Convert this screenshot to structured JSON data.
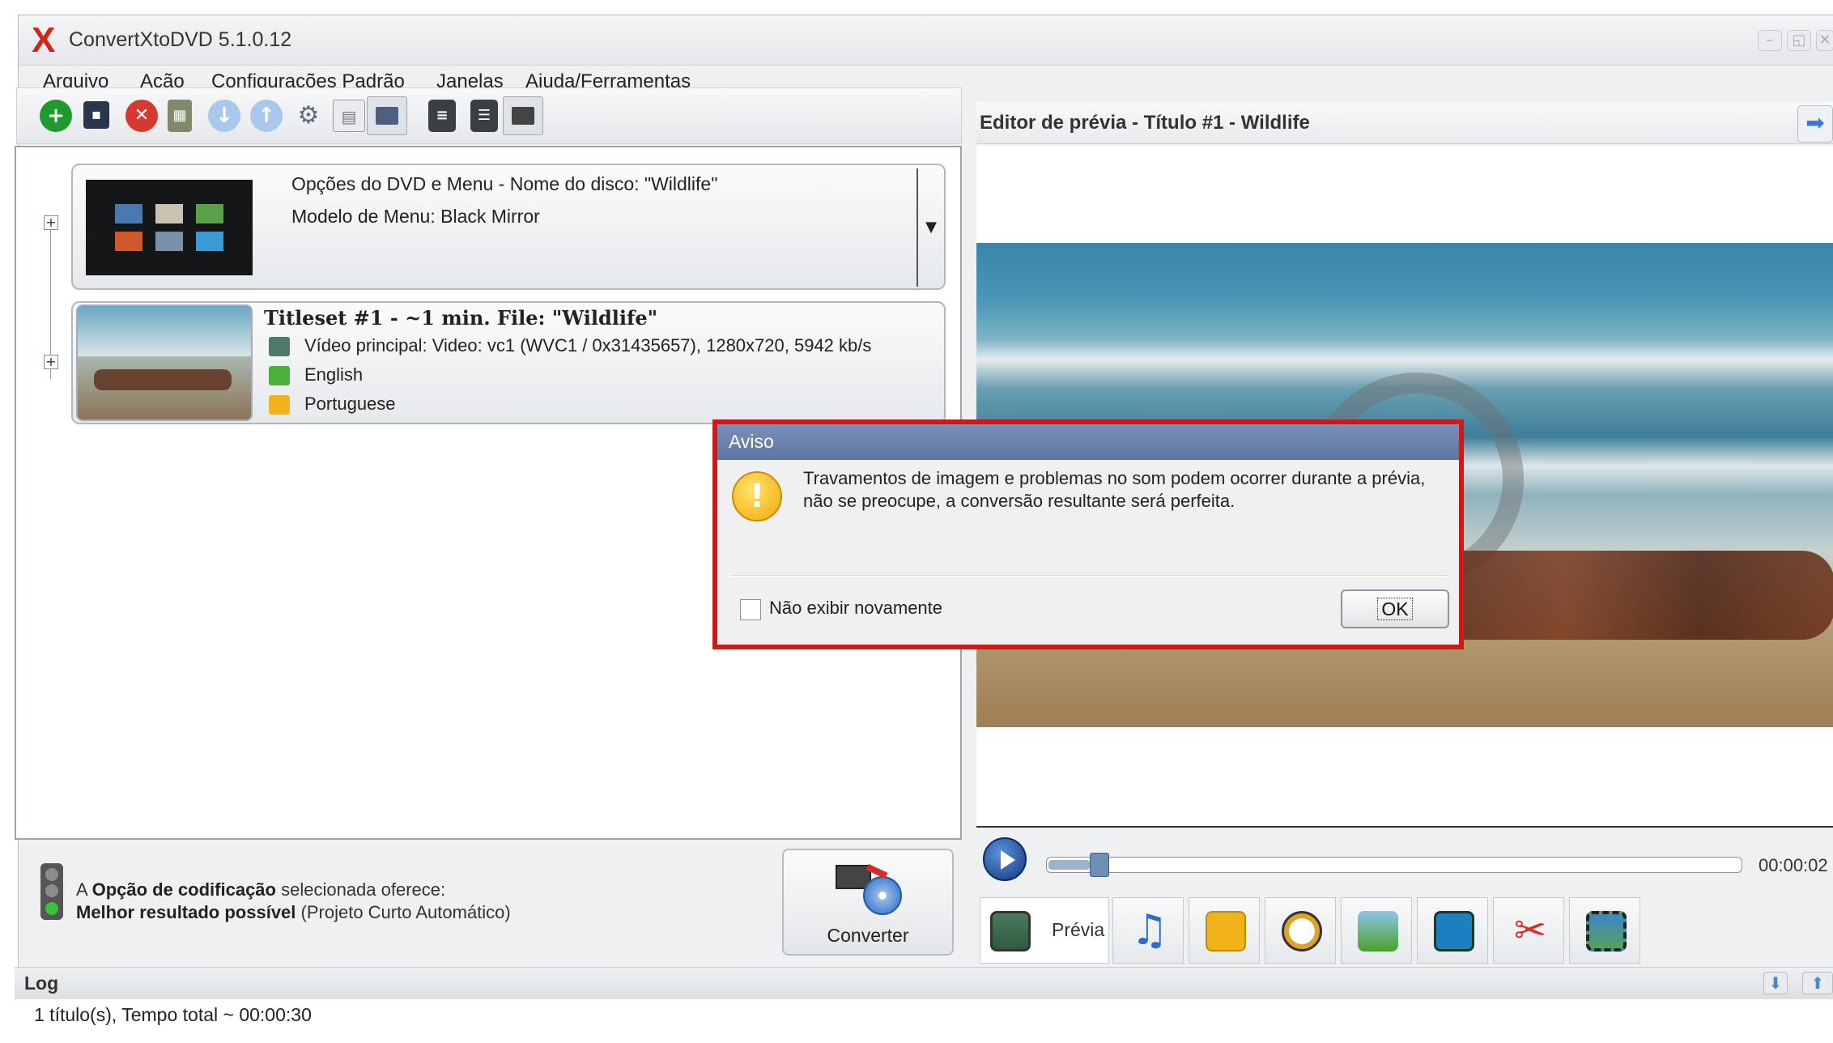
{
  "window": {
    "logo": "X",
    "title": "ConvertXtoDVD 5.1.0.12"
  },
  "menu": {
    "items": [
      "Arquivo",
      "Ação",
      "Configurações Padrão",
      "Janelas",
      "Ajuda/Ferramentas"
    ]
  },
  "toolbar": {
    "icons": [
      "add-icon",
      "save-icon",
      "remove-icon",
      "chapters-icon",
      "move-down-icon",
      "move-up-icon",
      "settings-icon",
      "menu-grid-icon",
      "preview-monitor-icon",
      "list-view-icon",
      "compact-view-icon",
      "tv-view-icon"
    ]
  },
  "project": {
    "dvd": {
      "line1": "Opções do DVD e Menu - Nome do disco: \"Wildlife\"",
      "line2": "Modelo de Menu: Black Mirror",
      "dropdown_glyph": "▼"
    },
    "titleset": {
      "header": "Titleset #1 - ~1 min. File: \"Wildlife\"",
      "video": "Vídeo principal: Video: vc1 (WVC1 / 0x31435657), 1280x720, 5942 kb/s",
      "audio": "English",
      "subtitle": "Portuguese"
    }
  },
  "encoding": {
    "prefix": "A ",
    "option_bold": "Opção de codificação",
    "suffix": " selecionada oferece:",
    "result_bold": "Melhor resultado possível",
    "result_note": " (Projeto Curto Automático)"
  },
  "convert": {
    "label": "Converter"
  },
  "log": {
    "label": "Log",
    "text": "1 título(s), Tempo total ~ 00:00:30"
  },
  "preview": {
    "title": "Editor de prévia - Título #1 - Wildlife",
    "time": "00:00:02",
    "seek_fraction": 0.06,
    "tab_label": "Prévia",
    "tabs": [
      "preview-tab-icon",
      "audio-tab-icon",
      "subtitle-tab-icon",
      "chapters-tab-icon",
      "effects-tab-icon",
      "crop-tab-icon",
      "cut-tab-icon",
      "film-tab-icon"
    ]
  },
  "dialog": {
    "title": "Aviso",
    "message_line1": "Travamentos de imagem e problemas no som podem ocorrer durante a prévia,",
    "message_line2": "não se preocupe, a conversão resultante será perfeita.",
    "checkbox_label": "Não exibir novamente",
    "ok_label": "OK"
  },
  "colors": {
    "highlight": "#d01818",
    "accent": "#3a7ad0"
  }
}
